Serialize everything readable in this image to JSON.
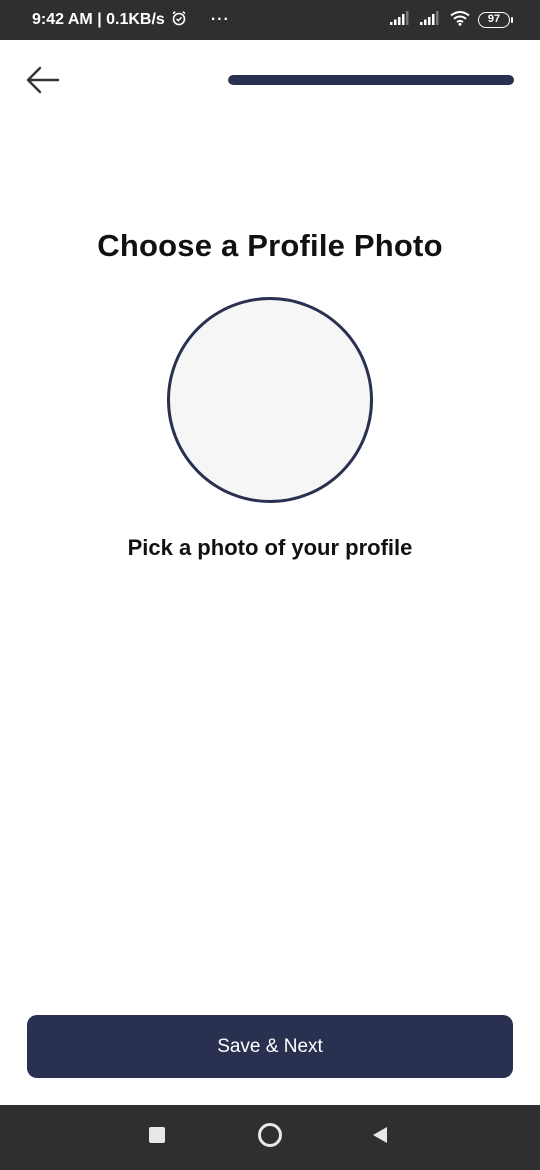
{
  "status_bar": {
    "time_speed": "9:42 AM | 0.1KB/s",
    "more_indicator": "···",
    "battery_level": "97",
    "icons": [
      "alarm-icon",
      "signal-icon",
      "signal-icon",
      "wifi-icon",
      "battery-icon"
    ]
  },
  "header": {
    "back_icon": "arrow-left-icon",
    "progress_fraction": 1.0
  },
  "main": {
    "title": "Choose a Profile Photo",
    "subtitle": "Pick a photo of your profile"
  },
  "actions": {
    "save_label": "Save & Next"
  },
  "nav": {
    "icons": [
      "recents-square-icon",
      "home-circle-icon",
      "back-triangle-icon"
    ]
  },
  "colors": {
    "primary": "#2a3150",
    "status_bar": "#2f2f31",
    "avatar_fill": "#f6f6f6"
  }
}
